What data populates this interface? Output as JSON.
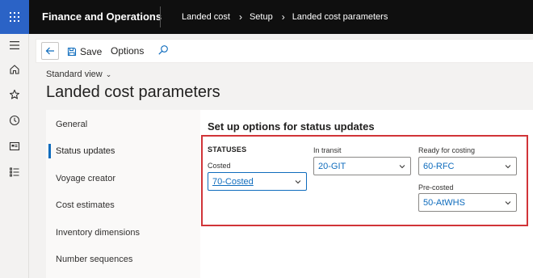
{
  "topbar": {
    "app_title": "Finance and Operations",
    "breadcrumbs": [
      "Landed cost",
      "Setup",
      "Landed cost parameters"
    ],
    "bg_color": "#0f0f0f",
    "waffle_color": "#2b63c6"
  },
  "leftnav": {
    "items": [
      "hamburger-icon",
      "home-icon",
      "star-icon",
      "clock-icon",
      "workspace-icon",
      "list-icon"
    ]
  },
  "actionbar": {
    "save_label": "Save",
    "options_label": "Options"
  },
  "header": {
    "view_label": "Standard view",
    "page_title": "Landed cost parameters"
  },
  "tabs": [
    {
      "label": "General",
      "active": false
    },
    {
      "label": "Status updates",
      "active": true
    },
    {
      "label": "Voyage creator",
      "active": false
    },
    {
      "label": "Cost estimates",
      "active": false
    },
    {
      "label": "Inventory dimensions",
      "active": false
    },
    {
      "label": "Number sequences",
      "active": false
    }
  ],
  "panel": {
    "title": "Set up options for status updates",
    "group_title": "STATUSES",
    "fields": {
      "costed": {
        "label": "Costed",
        "value": "70-Costed"
      },
      "in_transit": {
        "label": "In transit",
        "value": "20-GIT"
      },
      "ready_for_costing": {
        "label": "Ready for costing",
        "value": "60-RFC"
      },
      "pre_costed": {
        "label": "Pre-costed",
        "value": "50-AtWHS"
      }
    }
  },
  "colors": {
    "accent": "#0f6cbd",
    "highlight_border": "#d13438"
  }
}
